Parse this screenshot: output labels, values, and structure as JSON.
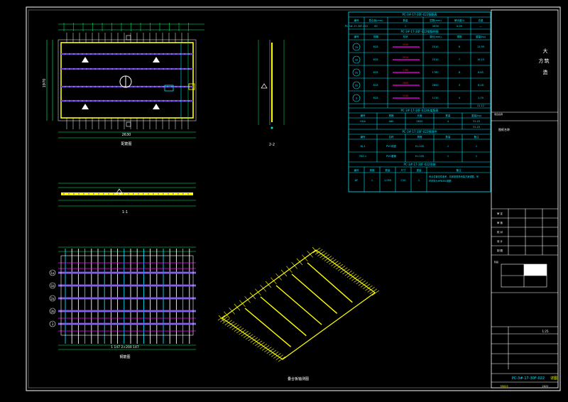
{
  "drawing": {
    "views": {
      "plan_title": "配筋图",
      "section_1_1": "1-1",
      "section_2_2": "2-2",
      "rebar_view_title": "钢筋图",
      "axo_title": "叠合板轴测图"
    },
    "dims": {
      "plan_bottom": "2630",
      "rebar_bottom": "1 147 2×200 147",
      "plan_left": "1970"
    },
    "table": {
      "title": "PC-3#-17-30F-022钢筋表",
      "header_row": [
        "编号",
        "叠合板(mm)",
        "数量",
        "层数(mm)",
        "单块重(t)",
        "总重"
      ],
      "id_row": [
        "PC-3#-17-30F-022",
        "60",
        "1",
        "2630",
        "0.09",
        "—"
      ],
      "rebar_title": "PC-3#-17-30F-022钢筋明细",
      "rebar_header": [
        "编号",
        "规格",
        "形状",
        "单长(mm)",
        "根数",
        "重量(kg)"
      ],
      "rebars": [
        {
          "id": "1a",
          "spec": "8C8",
          "len": "2510",
          "count": "6",
          "wt": "12.95"
        },
        {
          "id": "1b",
          "spec": "8C8",
          "len": "2510",
          "count": "7",
          "wt": "16.15"
        },
        {
          "id": "2a",
          "spec": "8C8",
          "len": "1760",
          "count": "8",
          "wt": "6.65"
        },
        {
          "id": "2b",
          "spec": "8C8",
          "len": "2800",
          "count": "3",
          "wt": "6.18"
        },
        {
          "id": "3",
          "spec": "8C8",
          "len": "1130",
          "count": "4",
          "wt": "1.79"
        }
      ],
      "rebar_total": "21.12",
      "truss_title": "PC-3#-17-30F-022桁架筋表",
      "truss_header": [
        "编号",
        "规格",
        "长度",
        "数量",
        "重量(kg)"
      ],
      "truss_rows": [
        [
          "HGA",
          "A80",
          "2630",
          "4",
          "31.25"
        ]
      ],
      "truss_total": "31.25",
      "emb_title": "PC-3#-17-30F-022预埋件",
      "emb_header": [
        "编号",
        "名称",
        "规格",
        "数量",
        "备注"
      ],
      "emb_rows": [
        [
          "DJ-1",
          "PVC线盒",
          "H=100",
          "1",
          "1"
        ],
        [
          "TKZ-1",
          "PVC套管",
          "H=100",
          "1",
          "1"
        ]
      ],
      "hook_title": "PC-3#-17-30F-022吊装",
      "hook_header": [
        "编号",
        "规格",
        "数量",
        "尺寸",
        "重量",
        "备注"
      ],
      "hook_rows": [
        [
          "DF",
          "1",
          "1.090",
          "C10",
          "1",
          "1"
        ]
      ],
      "hook_note": "吊点位置仅供参考，具体按现场吊装方案调整，吊环材料为HPB300钢筋"
    },
    "title_block": {
      "company_chars": [
        "大",
        "方",
        "筑",
        "造"
      ],
      "project_label": "项目名称",
      "drawing_name_label": "图纸名称",
      "rows": [
        "审 定",
        "审 核",
        "校 对",
        "设 计",
        "制 图"
      ],
      "stage_label": "阶段",
      "scale": "1:25",
      "drawing_no": "PC-3#-17-30F-022",
      "drawing_no_suffix": "详图",
      "bottom_code": "39023",
      "bottom_date": "2022"
    },
    "colors": {
      "yellow": "#ffff00",
      "cyan": "#00e5ff",
      "magenta": "#ff00ff",
      "purple": "#6e45d8",
      "green": "#00ff66",
      "white": "#ffffff",
      "red": "#ff2020"
    }
  }
}
